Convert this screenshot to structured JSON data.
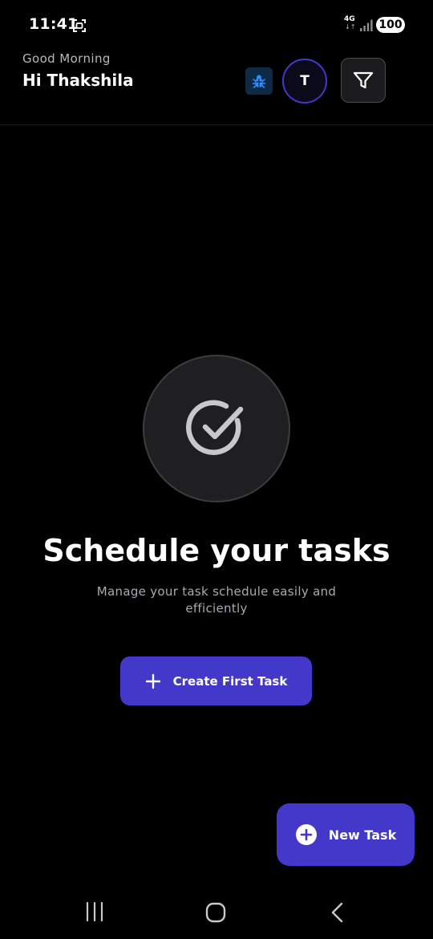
{
  "status_bar": {
    "time": "11:41",
    "network": "4G",
    "network_arrows": "↓↑",
    "battery": "100"
  },
  "header": {
    "greeting": "Good Morning",
    "user_name": "Hi Thakshila",
    "avatar_initial": "T"
  },
  "empty_state": {
    "title": "Schedule your tasks",
    "subtitle": "Manage your task schedule easily and efficiently",
    "cta_label": "Create First Task"
  },
  "fab": {
    "label": "New Task"
  },
  "icons": {
    "status": [
      "screen-record-icon",
      "signal-icon"
    ],
    "header": [
      "bug-icon",
      "filter-icon"
    ],
    "empty_state": "check-circle-icon",
    "buttons": [
      "plus-icon",
      "plus-circle-icon"
    ],
    "navigation": [
      "recents-icon",
      "home-icon",
      "back-icon"
    ]
  },
  "colors": {
    "background": "#000000",
    "accent": "#4338ca",
    "debug_badge_bg": "#0f2a45",
    "debug_icon": "#2f8cff",
    "muted_text": "#a9a9b0",
    "card_bg": "#1f1f21"
  }
}
